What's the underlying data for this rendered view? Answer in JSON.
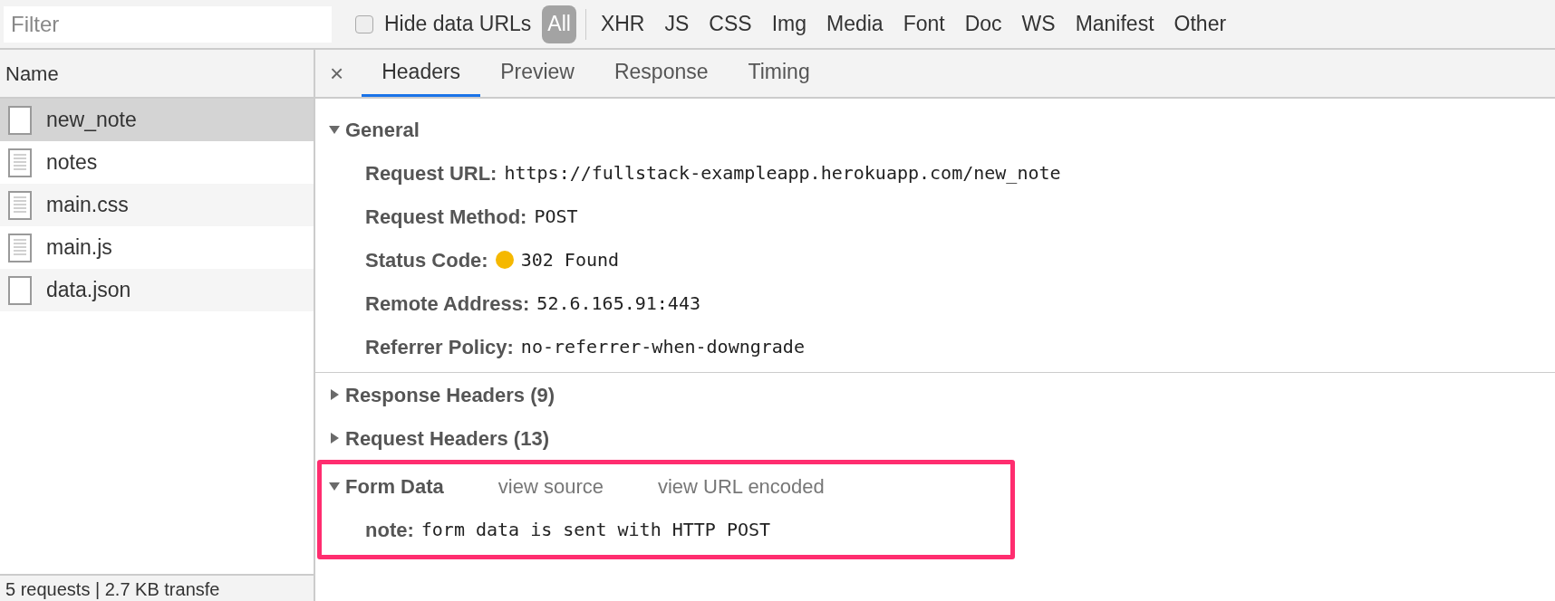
{
  "toolbar": {
    "filter": {
      "placeholder": "Filter"
    },
    "hide_data_urls": {
      "label": "Hide data URLs",
      "checked": false
    },
    "types": [
      {
        "label": "All",
        "selected": true
      },
      {
        "label": "XHR",
        "selected": false
      },
      {
        "label": "JS",
        "selected": false
      },
      {
        "label": "CSS",
        "selected": false
      },
      {
        "label": "Img",
        "selected": false
      },
      {
        "label": "Media",
        "selected": false
      },
      {
        "label": "Font",
        "selected": false
      },
      {
        "label": "Doc",
        "selected": false
      },
      {
        "label": "WS",
        "selected": false
      },
      {
        "label": "Manifest",
        "selected": false
      },
      {
        "label": "Other",
        "selected": false
      }
    ]
  },
  "requests": {
    "column": "Name",
    "rows": [
      {
        "name": "new_note",
        "kind": "blank",
        "selected": true
      },
      {
        "name": "notes",
        "kind": "document",
        "selected": false
      },
      {
        "name": "main.css",
        "kind": "document",
        "selected": false
      },
      {
        "name": "main.js",
        "kind": "document",
        "selected": false
      },
      {
        "name": "data.json",
        "kind": "blank",
        "selected": false
      }
    ],
    "status_bar": "5 requests | 2.7 KB transfe"
  },
  "detail": {
    "close": "×",
    "tabs": [
      {
        "label": "Headers",
        "selected": true
      },
      {
        "label": "Preview",
        "selected": false
      },
      {
        "label": "Response",
        "selected": false
      },
      {
        "label": "Timing",
        "selected": false
      }
    ],
    "sections": [
      {
        "title": "General",
        "expanded": true,
        "highlighted": false,
        "rows": [
          {
            "key": "Request URL:",
            "value": "https://fullstack-exampleapp.herokuapp.com/new_note"
          },
          {
            "key": "Request Method:",
            "value": "POST"
          },
          {
            "key": "Status Code:",
            "value": "302 Found",
            "color": "#f5b800"
          },
          {
            "key": "Remote Address:",
            "value": "52.6.165.91:443"
          },
          {
            "key": "Referrer Policy:",
            "value": "no-referrer-when-downgrade"
          }
        ]
      },
      {
        "title": "Response Headers (9)",
        "expanded": false,
        "highlighted": false
      },
      {
        "title": "Request Headers (13)",
        "expanded": false,
        "highlighted": false
      },
      {
        "title": "Form Data",
        "expanded": true,
        "highlighted": true,
        "links": [
          "view source",
          "view URL encoded"
        ],
        "rows": [
          {
            "key": "note:",
            "value": "form data is sent with HTTP POST"
          }
        ]
      }
    ]
  }
}
